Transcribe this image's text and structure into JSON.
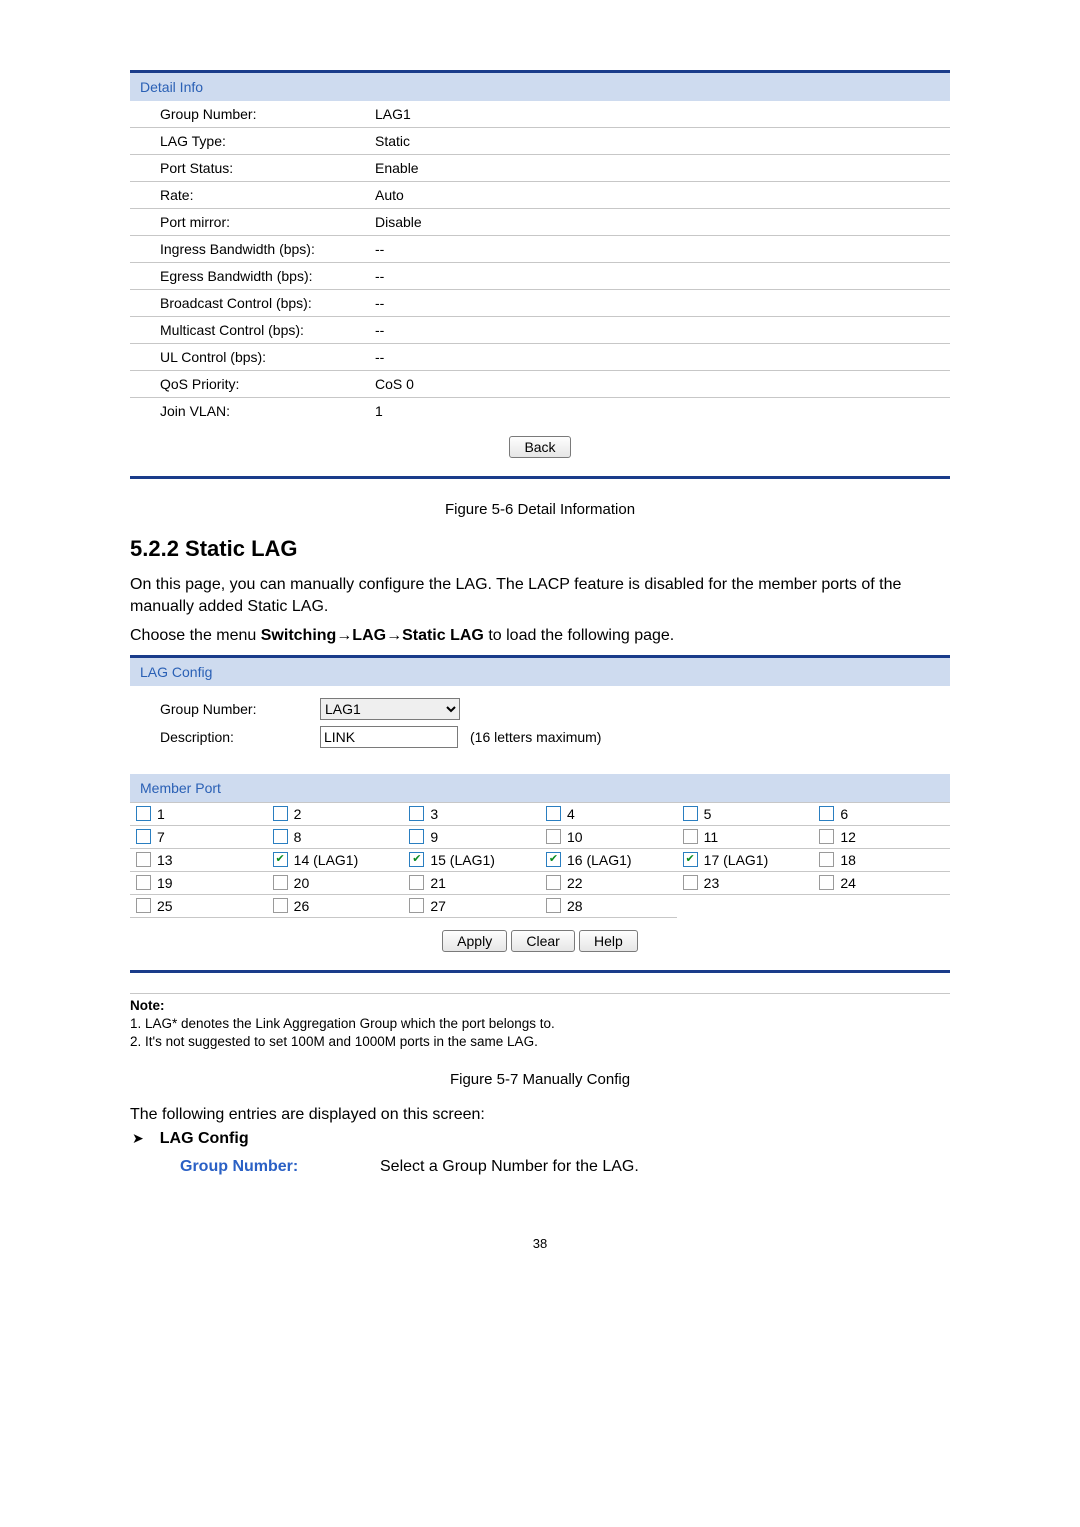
{
  "detail_info": {
    "header": "Detail Info",
    "rows": [
      {
        "label": "Group Number:",
        "value": "LAG1"
      },
      {
        "label": "LAG Type:",
        "value": "Static"
      },
      {
        "label": "Port Status:",
        "value": "Enable"
      },
      {
        "label": "Rate:",
        "value": "Auto"
      },
      {
        "label": "Port mirror:",
        "value": "Disable"
      },
      {
        "label": "Ingress Bandwidth (bps):",
        "value": "--"
      },
      {
        "label": "Egress Bandwidth (bps):",
        "value": "--"
      },
      {
        "label": "Broadcast Control (bps):",
        "value": "--"
      },
      {
        "label": "Multicast Control (bps):",
        "value": "--"
      },
      {
        "label": "UL Control (bps):",
        "value": "--"
      },
      {
        "label": "QoS Priority:",
        "value": "CoS 0"
      },
      {
        "label": "Join VLAN:",
        "value": "1"
      }
    ],
    "back_label": "Back"
  },
  "caption1": "Figure 5-6 Detail Information",
  "section": {
    "heading": "5.2.2 Static LAG",
    "para1": "On this page, you can manually configure the LAG. The LACP feature is disabled for the member ports of the manually added Static LAG.",
    "para2_pre": "Choose the menu ",
    "para2_bold": "Switching→LAG→Static LAG",
    "para2_post": " to load the following page."
  },
  "lag_config": {
    "header": "LAG Config",
    "group_number_label": "Group Number:",
    "group_number_value": "LAG1",
    "description_label": "Description:",
    "description_value": "LINK",
    "description_hint": "(16 letters maximum)"
  },
  "member_port": {
    "header": "Member Port",
    "ports": [
      {
        "n": "1",
        "checked": false,
        "enabled": true,
        "suffix": ""
      },
      {
        "n": "2",
        "checked": false,
        "enabled": true,
        "suffix": ""
      },
      {
        "n": "3",
        "checked": false,
        "enabled": true,
        "suffix": ""
      },
      {
        "n": "4",
        "checked": false,
        "enabled": true,
        "suffix": ""
      },
      {
        "n": "5",
        "checked": false,
        "enabled": true,
        "suffix": ""
      },
      {
        "n": "6",
        "checked": false,
        "enabled": true,
        "suffix": ""
      },
      {
        "n": "7",
        "checked": false,
        "enabled": true,
        "suffix": ""
      },
      {
        "n": "8",
        "checked": false,
        "enabled": true,
        "suffix": ""
      },
      {
        "n": "9",
        "checked": false,
        "enabled": true,
        "suffix": ""
      },
      {
        "n": "10",
        "checked": false,
        "enabled": false,
        "suffix": ""
      },
      {
        "n": "11",
        "checked": false,
        "enabled": false,
        "suffix": ""
      },
      {
        "n": "12",
        "checked": false,
        "enabled": false,
        "suffix": ""
      },
      {
        "n": "13",
        "checked": false,
        "enabled": false,
        "suffix": ""
      },
      {
        "n": "14",
        "checked": true,
        "enabled": true,
        "suffix": " (LAG1)"
      },
      {
        "n": "15",
        "checked": true,
        "enabled": true,
        "suffix": " (LAG1)"
      },
      {
        "n": "16",
        "checked": true,
        "enabled": true,
        "suffix": " (LAG1)"
      },
      {
        "n": "17",
        "checked": true,
        "enabled": true,
        "suffix": " (LAG1)"
      },
      {
        "n": "18",
        "checked": false,
        "enabled": false,
        "suffix": ""
      },
      {
        "n": "19",
        "checked": false,
        "enabled": false,
        "suffix": ""
      },
      {
        "n": "20",
        "checked": false,
        "enabled": false,
        "suffix": ""
      },
      {
        "n": "21",
        "checked": false,
        "enabled": false,
        "suffix": ""
      },
      {
        "n": "22",
        "checked": false,
        "enabled": false,
        "suffix": ""
      },
      {
        "n": "23",
        "checked": false,
        "enabled": false,
        "suffix": ""
      },
      {
        "n": "24",
        "checked": false,
        "enabled": false,
        "suffix": ""
      },
      {
        "n": "25",
        "checked": false,
        "enabled": false,
        "suffix": ""
      },
      {
        "n": "26",
        "checked": false,
        "enabled": false,
        "suffix": ""
      },
      {
        "n": "27",
        "checked": false,
        "enabled": false,
        "suffix": ""
      },
      {
        "n": "28",
        "checked": false,
        "enabled": false,
        "suffix": ""
      }
    ],
    "buttons": {
      "apply": "Apply",
      "clear": "Clear",
      "help": "Help"
    }
  },
  "note": {
    "title": "Note:",
    "line1": "1. LAG* denotes the Link Aggregation Group which the port belongs to.",
    "line2": "2. It's not suggested to set 100M and 1000M ports in the same LAG."
  },
  "caption2": "Figure 5-7 Manually Config",
  "entries_intro": "The following entries are displayed on this screen:",
  "lag_config_bullet": "LAG Config",
  "def": {
    "term": "Group Number:",
    "desc": "Select a Group Number for the LAG."
  },
  "page_number": "38"
}
